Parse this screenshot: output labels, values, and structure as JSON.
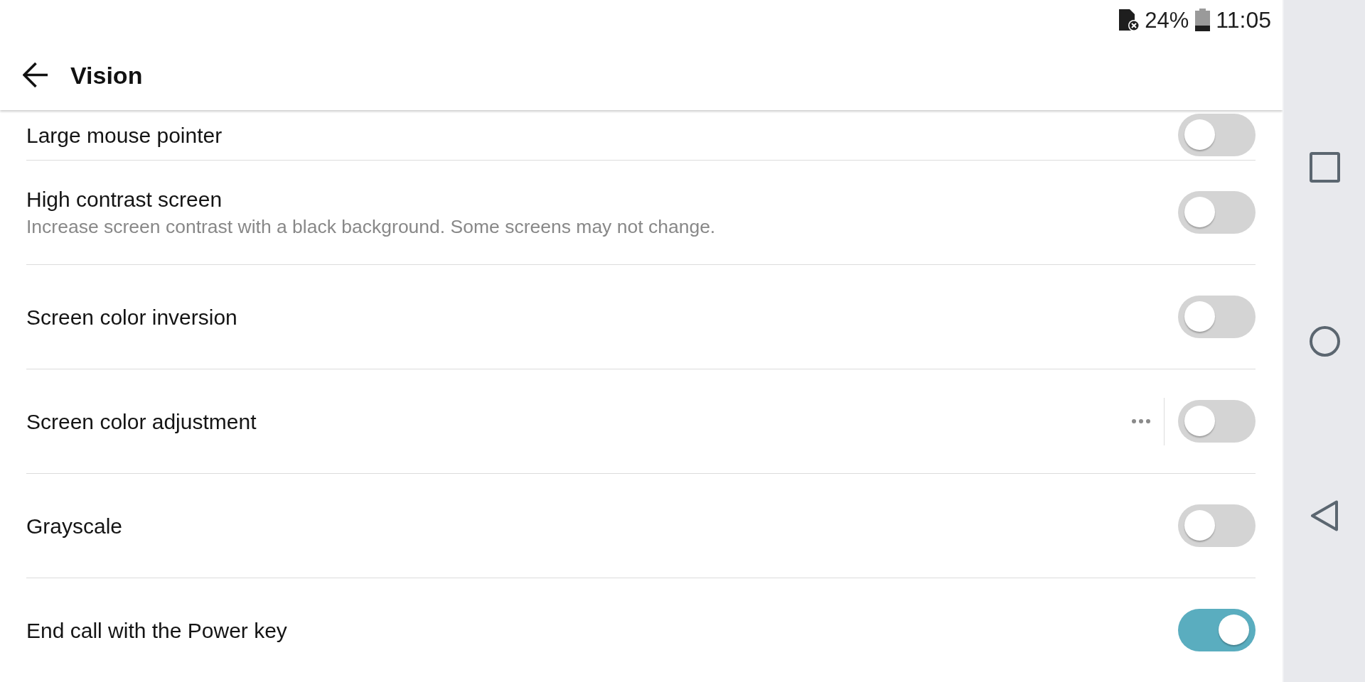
{
  "status_bar": {
    "battery_percent": "24%",
    "time": "11:05"
  },
  "header": {
    "title": "Vision"
  },
  "settings": [
    {
      "kind": "switch",
      "title": "Large mouse pointer",
      "on": false
    },
    {
      "kind": "switch",
      "title": "High contrast screen",
      "subtitle": "Increase screen contrast with a black background. Some screens may not change.",
      "on": false
    },
    {
      "kind": "switch",
      "title": "Screen color inversion",
      "on": false
    },
    {
      "kind": "switch_with_options",
      "title": "Screen color adjustment",
      "on": false
    },
    {
      "kind": "switch",
      "title": "Grayscale",
      "on": false
    },
    {
      "kind": "switch",
      "title": "End call with the Power key",
      "on": true
    }
  ]
}
